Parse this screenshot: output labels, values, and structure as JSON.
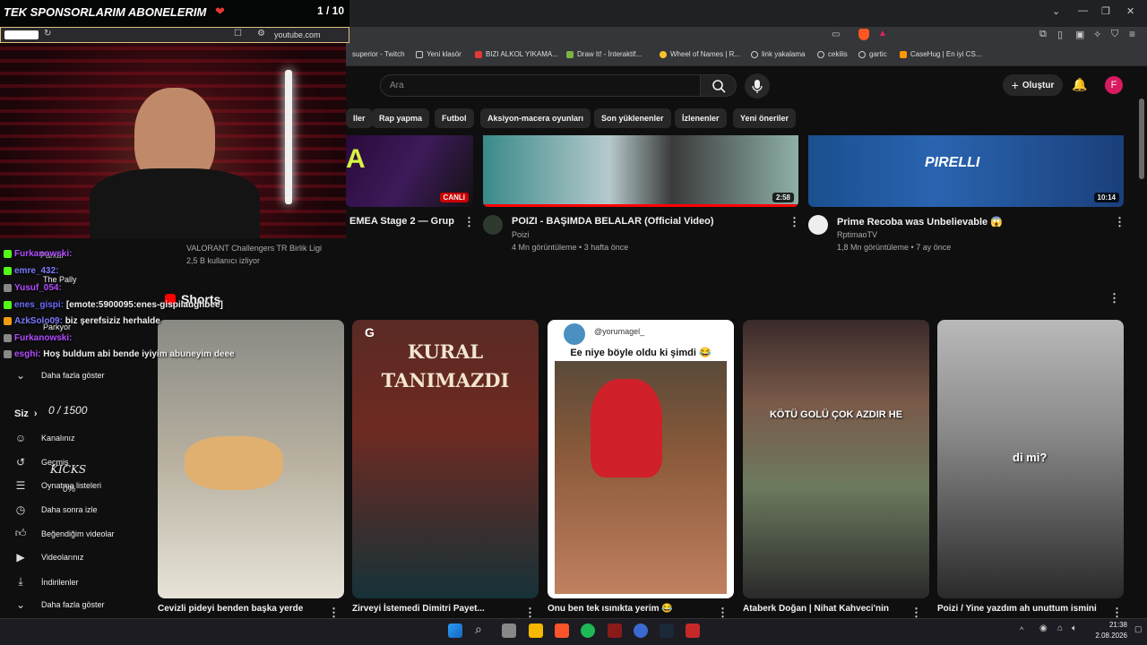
{
  "overlay": {
    "sponsor_banner": "TEK SPONSORLARIM ABONELERIM",
    "counter": "1 / 10",
    "sub_goal": "0 / 1500",
    "kicks_label": "KICKS",
    "kicks_pct": "0%"
  },
  "browser": {
    "url": "youtube.com",
    "bookmarks": [
      "superior - Twitch",
      "Yeni klasör",
      "BIZI ALKOL YIKAMA...",
      "Draw It! - İnteraktif...",
      "Wheel of Names | R...",
      "link yakalama",
      "cekilis",
      "gartic",
      "CaseHug | En iyi CS..."
    ]
  },
  "youtube": {
    "search_placeholder": "Ara",
    "create_label": "Oluştur",
    "avatar_letter": "F",
    "chips": [
      "ller",
      "Rap yapma",
      "Futbol",
      "Aksiyon-macera oyunları",
      "Son yüklenenler",
      "İzlenenler",
      "Yeni öneriler"
    ],
    "videos": [
      {
        "title": "EMEA Stage 2 — Grup",
        "channel": "VALORANT Challengers TR Birlik Ligi",
        "meta": "2,5 B kullanıcı izliyor",
        "badge": "CANLI"
      },
      {
        "title": "POIZI - BAŞIMDA BELALAR (Official Video)",
        "channel": "Poizi",
        "meta": "4 Mn görüntüleme • 3 hafta önce",
        "duration": "2:58"
      },
      {
        "title": "Prime Recoba was Unbelievable 😱",
        "channel": "RptimaoTV",
        "meta": "1,8 Mn görüntüleme • 7 ay önce",
        "duration": "10:14"
      }
    ],
    "shorts_heading": "Shorts",
    "shorts": [
      {
        "title": "Cevizli pideyi benden başka yerde",
        "overlay": ""
      },
      {
        "title": "Zirveyi İstemedi Dimitri Payet...",
        "overlay": "KURAL TANIMAZDI"
      },
      {
        "title": "Onu ben tek ısınıkta yerim 😂",
        "overlay": "Ee niye böyle oldu ki şimdi 😂",
        "handle": "@yorumagel_"
      },
      {
        "title": "Ataberk Doğan | Nihat Kahveci'nin",
        "overlay": "KÖTÜ GOLÜ ÇOK AZDIR HE"
      },
      {
        "title": "Poizi / Yine yazdım ah unuttum ismini",
        "overlay": "di mi?"
      }
    ],
    "sidebar": {
      "show_more": "Daha fazla göster",
      "you_label": "Siz",
      "items": [
        "Kanalınız",
        "Geçmiş",
        "Oynatma listeleri",
        "Daha sonra izle",
        "Beğendiğim videolar",
        "Videolarınız",
        "İndirilenler"
      ],
      "show_more_2": "Daha fazla göster",
      "subs": [
        "Parkur",
        "The Pally",
        "Parkyor"
      ]
    }
  },
  "chat": [
    {
      "user": "Furkanowski:",
      "msg": "",
      "color": "#b14bff"
    },
    {
      "user": "emre_432:",
      "msg": "",
      "color": "#7a7aff"
    },
    {
      "user": "Yusuf_054:",
      "msg": "",
      "color": "#b14bff"
    },
    {
      "user": "enes_gispi:",
      "msg": "[emote:5900095:enes-gispilaughbee]",
      "color": "#6a6aff"
    },
    {
      "user": "AzkSolo09:",
      "msg": "biz şerefsiziz herhalde",
      "color": "#7a7aff"
    },
    {
      "user": "Furkanowski:",
      "msg": "",
      "color": "#b14bff"
    },
    {
      "user": "esghi:",
      "msg": "Hoş buldum abi bende iyiyim abuneyim deee",
      "color": "#b14bff"
    }
  ],
  "taskbar": {
    "time": "21:38",
    "date": "2.08.2026"
  },
  "colors": {
    "accent": "#ff0000",
    "bg": "#0f0f0f",
    "avatar": "#d81b60"
  }
}
